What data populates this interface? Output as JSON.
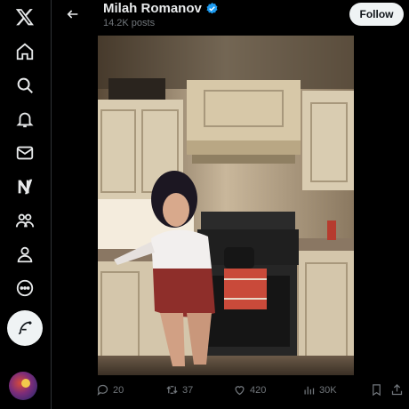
{
  "sidebar": {
    "items": [
      {
        "icon": "x-logo-icon"
      },
      {
        "icon": "home-icon"
      },
      {
        "icon": "search-icon"
      },
      {
        "icon": "notifications-bell-icon"
      },
      {
        "icon": "messages-envelope-icon"
      },
      {
        "icon": "grok-icon"
      },
      {
        "icon": "communities-icon"
      },
      {
        "icon": "profile-icon"
      },
      {
        "icon": "more-circle-icon"
      }
    ],
    "compose_icon": "feather-post-icon"
  },
  "header": {
    "name": "Milah Romanov",
    "posts_count": "14.2K posts",
    "follow_label": "Follow"
  },
  "colors": {
    "background": "#000000",
    "text": "#e7e9ea",
    "muted": "#71767b",
    "verified": "#1d9bf0",
    "follow_bg": "#eff3f4"
  },
  "actions": {
    "replies": "20",
    "reposts": "37",
    "likes": "420",
    "views": "30K"
  }
}
